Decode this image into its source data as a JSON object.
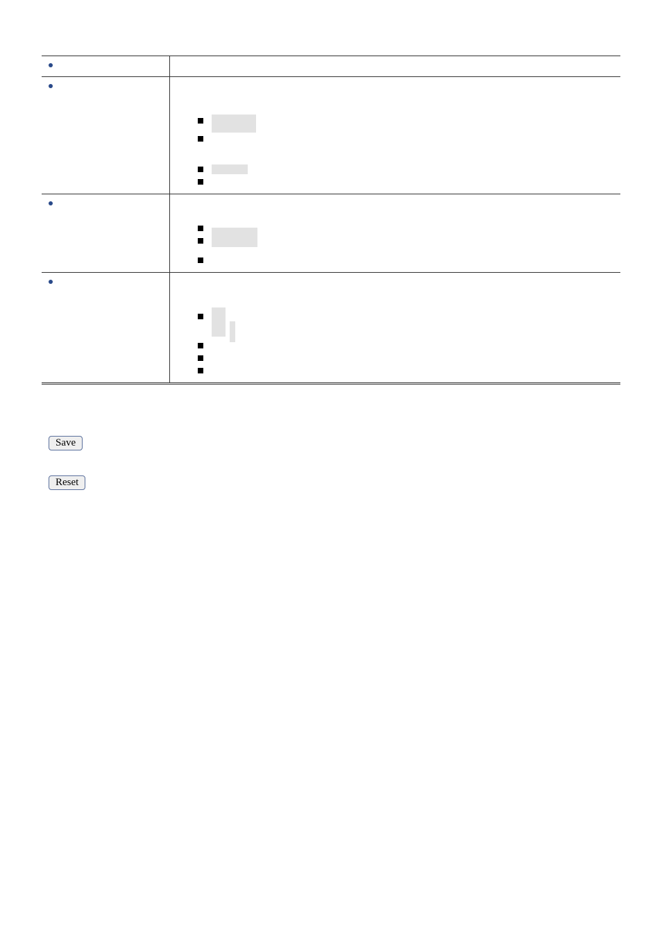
{
  "buttons": {
    "save_label": "Save",
    "reset_label": "Reset"
  },
  "table": {
    "rows": [
      {
        "left_label": "",
        "desc_lines": [],
        "sub_items": []
      },
      {
        "left_label": "",
        "desc_lines": [
          "",
          ""
        ],
        "sub_items": [
          {
            "label": "",
            "placeholder_w": 64,
            "placeholder_h": 26
          },
          {
            "label": "",
            "placeholder_w": 0,
            "placeholder_h": 0
          },
          {
            "label": "",
            "placeholder_w": 52,
            "placeholder_h": 14,
            "gap_before": true
          },
          {
            "label": "",
            "placeholder_w": 0,
            "placeholder_h": 0
          }
        ]
      },
      {
        "left_label": "",
        "desc_lines": [
          ""
        ],
        "sub_items": [
          {
            "label": "",
            "placeholder_w": 0,
            "placeholder_h": 0
          },
          {
            "label": "",
            "placeholder_w": 66,
            "placeholder_h": 28,
            "placeholder_shift": true
          },
          {
            "label": "",
            "placeholder_w": 0,
            "placeholder_h": 0
          }
        ]
      },
      {
        "left_label": "",
        "desc_lines": [
          "",
          ""
        ],
        "sub_items": [
          {
            "label": "",
            "placeholder_w": 26,
            "placeholder_h": 26,
            "placeholder_shape": "notch"
          },
          {
            "label": "",
            "placeholder_w": 0,
            "placeholder_h": 0
          },
          {
            "label": "",
            "placeholder_w": 0,
            "placeholder_h": 0
          },
          {
            "label": "",
            "placeholder_w": 0,
            "placeholder_h": 0
          }
        ]
      }
    ]
  }
}
